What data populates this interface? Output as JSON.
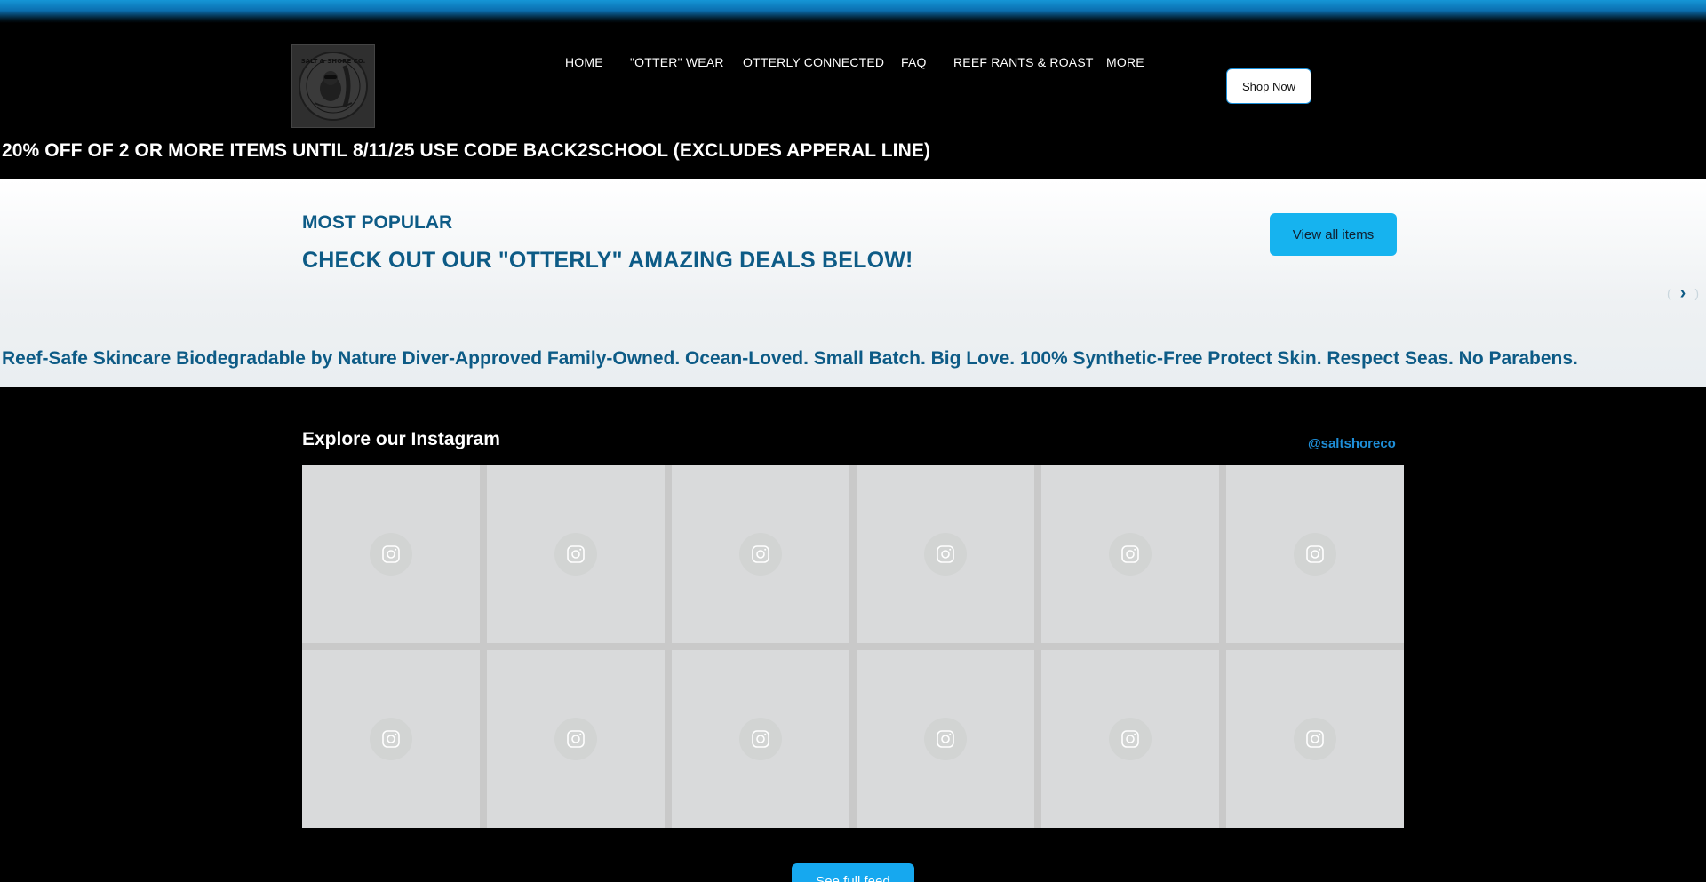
{
  "colors": {
    "accent": "#16b3ef",
    "brand_text": "#0d5b86",
    "background": "#000000",
    "link": "#1e8ed8"
  },
  "header": {
    "logo": "SALT & SHORE CO.",
    "nav": [
      {
        "label": "HOME"
      },
      {
        "label": "\"OTTER\" WEAR"
      },
      {
        "label": "OTTERLY CONNECTED"
      },
      {
        "label": "FAQ"
      },
      {
        "label": "REEF RANTS & ROAST"
      },
      {
        "label": "MORE"
      }
    ],
    "shop_button": "Shop Now"
  },
  "promo_banner": "20% OFF OF 2 OR MORE ITEMS UNTIL 8/11/25 USE CODE BACK2SCHOOL (EXCLUDES APPERAL LINE)",
  "most_popular": {
    "eyebrow": "MOST POPULAR",
    "heading": "CHECK OUT OUR \"OTTERLY\" AMAZING DEALS BELOW!",
    "view_all": "View all items",
    "next_icon": "chevron-right-icon"
  },
  "marquee": "Reef-Safe Skincare Biodegradable by Nature Diver-Approved Family-Owned. Ocean-Loved. Small Batch. Big Love. 100% Synthetic-Free Protect Skin. Respect Seas. No Parabens.",
  "instagram": {
    "title": "Explore our Instagram",
    "handle": "@saltshoreco_",
    "tile_icon": "instagram-icon",
    "tile_count": 12,
    "feed_button": "See full feed"
  }
}
